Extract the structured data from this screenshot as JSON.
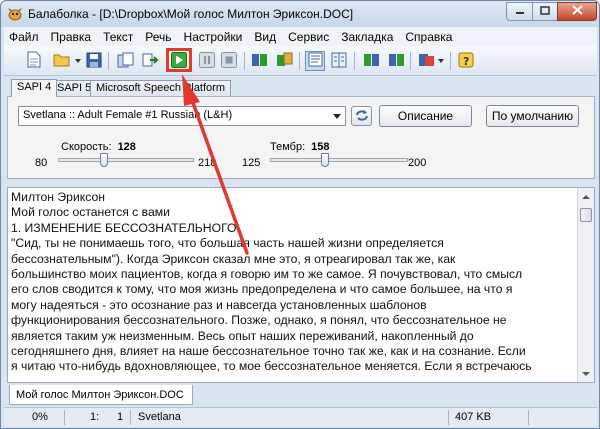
{
  "window": {
    "title": "Балаболка - [D:\\Dropbox\\Мой голос Милтон Эриксон.DOC]",
    "controls": [
      "minimize-icon",
      "maximize-icon",
      "close-icon"
    ]
  },
  "menu": {
    "items": [
      "Файл",
      "Правка",
      "Текст",
      "Речь",
      "Настройки",
      "Вид",
      "Сервис",
      "Закладка",
      "Справка"
    ]
  },
  "toolbar": {
    "buttons": [
      "new-document-icon",
      "open-folder-icon",
      "save-icon",
      "copy-to-clipboard-icon",
      "convert-icon",
      "play-icon",
      "pause-icon",
      "stop-icon",
      "save-audio-icon",
      "subtitles-icon",
      "text-mode-icon",
      "split-view-icon",
      "spellcheck-icon",
      "translate-icon",
      "bookmark-icon",
      "help-icon"
    ],
    "highlighted": "play-icon",
    "highlight_color": "#e03a2f"
  },
  "tabs": {
    "items": [
      "SAPI 4",
      "SAPI 5",
      "Microsoft Speech Platform"
    ],
    "active": "SAPI 4"
  },
  "voice": {
    "selected": "Svetlana :: Adult Female #1 Russian (L&H)",
    "description_button": "Описание",
    "default_button": "По умолчанию"
  },
  "rate": {
    "label": "Скорость:",
    "value": "128",
    "min": "80",
    "max": "218"
  },
  "pitch": {
    "label": "Тембр:",
    "value": "158",
    "min": "125",
    "max": "200"
  },
  "document": {
    "lines": [
      "Милтон Эриксон",
      "Мой голос останется с вами",
      "1. ИЗМЕНЕНИЕ БЕССОЗНАТЕЛЬНОГО",
      "\"Сид, ты не понимаешь того, что большая часть нашей жизни определяется",
      "бессознательным\"). Когда Эриксон сказал мне это, я отреагировал так же, как",
      "большинство моих пациентов, когда я говорю им то же самое. Я почувствовал, что смысл",
      "его слов сводится к тому, что моя жизнь предопределена и что самое большее, на что я",
      "могу надеяться - это осознание раз и навсегда установленных шаблонов",
      "функционирования бессознательного. Позже, однако, я понял, что бессознательное не",
      "является таким уж неизменным. Весь опыт наших переживаний, накопленный до",
      "сегодняшнего дня, влияет на наше бессознательное точно так же, как и на сознание. Если",
      "я читаю что-нибудь вдохновляющее, то мое бессознательное меняется. Если я встречаюсь"
    ],
    "tab_label": "Мой голос Милтон Эриксон.DOC"
  },
  "status": {
    "progress": "0%",
    "line": "1:",
    "column": "1",
    "voice": "Svetlana",
    "size": "407 KB"
  },
  "colors": {
    "accent": "#e03a2f",
    "play_green": "#2e9b2e"
  }
}
